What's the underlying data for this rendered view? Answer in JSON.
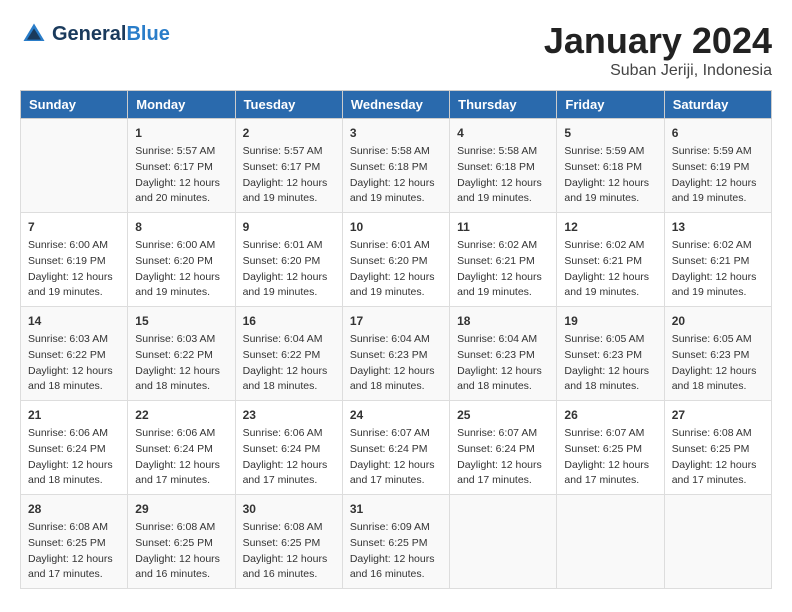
{
  "header": {
    "logo_general": "General",
    "logo_blue": "Blue",
    "month_title": "January 2024",
    "location": "Suban Jeriji, Indonesia"
  },
  "days_of_week": [
    "Sunday",
    "Monday",
    "Tuesday",
    "Wednesday",
    "Thursday",
    "Friday",
    "Saturday"
  ],
  "weeks": [
    [
      {
        "day": "",
        "info": ""
      },
      {
        "day": "1",
        "info": "Sunrise: 5:57 AM\nSunset: 6:17 PM\nDaylight: 12 hours\nand 20 minutes."
      },
      {
        "day": "2",
        "info": "Sunrise: 5:57 AM\nSunset: 6:17 PM\nDaylight: 12 hours\nand 19 minutes."
      },
      {
        "day": "3",
        "info": "Sunrise: 5:58 AM\nSunset: 6:18 PM\nDaylight: 12 hours\nand 19 minutes."
      },
      {
        "day": "4",
        "info": "Sunrise: 5:58 AM\nSunset: 6:18 PM\nDaylight: 12 hours\nand 19 minutes."
      },
      {
        "day": "5",
        "info": "Sunrise: 5:59 AM\nSunset: 6:18 PM\nDaylight: 12 hours\nand 19 minutes."
      },
      {
        "day": "6",
        "info": "Sunrise: 5:59 AM\nSunset: 6:19 PM\nDaylight: 12 hours\nand 19 minutes."
      }
    ],
    [
      {
        "day": "7",
        "info": "Sunrise: 6:00 AM\nSunset: 6:19 PM\nDaylight: 12 hours\nand 19 minutes."
      },
      {
        "day": "8",
        "info": "Sunrise: 6:00 AM\nSunset: 6:20 PM\nDaylight: 12 hours\nand 19 minutes."
      },
      {
        "day": "9",
        "info": "Sunrise: 6:01 AM\nSunset: 6:20 PM\nDaylight: 12 hours\nand 19 minutes."
      },
      {
        "day": "10",
        "info": "Sunrise: 6:01 AM\nSunset: 6:20 PM\nDaylight: 12 hours\nand 19 minutes."
      },
      {
        "day": "11",
        "info": "Sunrise: 6:02 AM\nSunset: 6:21 PM\nDaylight: 12 hours\nand 19 minutes."
      },
      {
        "day": "12",
        "info": "Sunrise: 6:02 AM\nSunset: 6:21 PM\nDaylight: 12 hours\nand 19 minutes."
      },
      {
        "day": "13",
        "info": "Sunrise: 6:02 AM\nSunset: 6:21 PM\nDaylight: 12 hours\nand 19 minutes."
      }
    ],
    [
      {
        "day": "14",
        "info": "Sunrise: 6:03 AM\nSunset: 6:22 PM\nDaylight: 12 hours\nand 18 minutes."
      },
      {
        "day": "15",
        "info": "Sunrise: 6:03 AM\nSunset: 6:22 PM\nDaylight: 12 hours\nand 18 minutes."
      },
      {
        "day": "16",
        "info": "Sunrise: 6:04 AM\nSunset: 6:22 PM\nDaylight: 12 hours\nand 18 minutes."
      },
      {
        "day": "17",
        "info": "Sunrise: 6:04 AM\nSunset: 6:23 PM\nDaylight: 12 hours\nand 18 minutes."
      },
      {
        "day": "18",
        "info": "Sunrise: 6:04 AM\nSunset: 6:23 PM\nDaylight: 12 hours\nand 18 minutes."
      },
      {
        "day": "19",
        "info": "Sunrise: 6:05 AM\nSunset: 6:23 PM\nDaylight: 12 hours\nand 18 minutes."
      },
      {
        "day": "20",
        "info": "Sunrise: 6:05 AM\nSunset: 6:23 PM\nDaylight: 12 hours\nand 18 minutes."
      }
    ],
    [
      {
        "day": "21",
        "info": "Sunrise: 6:06 AM\nSunset: 6:24 PM\nDaylight: 12 hours\nand 18 minutes."
      },
      {
        "day": "22",
        "info": "Sunrise: 6:06 AM\nSunset: 6:24 PM\nDaylight: 12 hours\nand 17 minutes."
      },
      {
        "day": "23",
        "info": "Sunrise: 6:06 AM\nSunset: 6:24 PM\nDaylight: 12 hours\nand 17 minutes."
      },
      {
        "day": "24",
        "info": "Sunrise: 6:07 AM\nSunset: 6:24 PM\nDaylight: 12 hours\nand 17 minutes."
      },
      {
        "day": "25",
        "info": "Sunrise: 6:07 AM\nSunset: 6:24 PM\nDaylight: 12 hours\nand 17 minutes."
      },
      {
        "day": "26",
        "info": "Sunrise: 6:07 AM\nSunset: 6:25 PM\nDaylight: 12 hours\nand 17 minutes."
      },
      {
        "day": "27",
        "info": "Sunrise: 6:08 AM\nSunset: 6:25 PM\nDaylight: 12 hours\nand 17 minutes."
      }
    ],
    [
      {
        "day": "28",
        "info": "Sunrise: 6:08 AM\nSunset: 6:25 PM\nDaylight: 12 hours\nand 17 minutes."
      },
      {
        "day": "29",
        "info": "Sunrise: 6:08 AM\nSunset: 6:25 PM\nDaylight: 12 hours\nand 16 minutes."
      },
      {
        "day": "30",
        "info": "Sunrise: 6:08 AM\nSunset: 6:25 PM\nDaylight: 12 hours\nand 16 minutes."
      },
      {
        "day": "31",
        "info": "Sunrise: 6:09 AM\nSunset: 6:25 PM\nDaylight: 12 hours\nand 16 minutes."
      },
      {
        "day": "",
        "info": ""
      },
      {
        "day": "",
        "info": ""
      },
      {
        "day": "",
        "info": ""
      }
    ]
  ]
}
